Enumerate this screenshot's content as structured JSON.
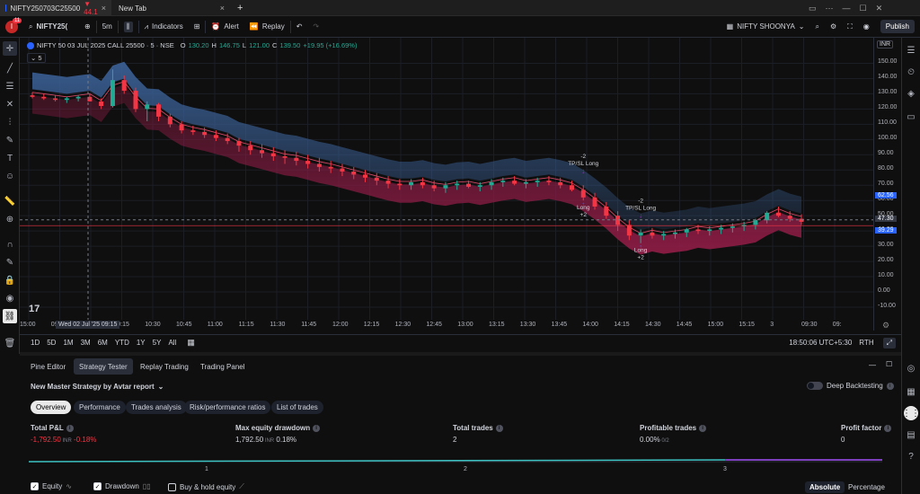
{
  "browser": {
    "tabs": [
      {
        "title": "NIFTY250703C25500",
        "price": "▼ 44.1",
        "close": "×"
      },
      {
        "title": "New Tab",
        "close": "×"
      }
    ],
    "new_tab": "+"
  },
  "toolbar": {
    "avatar_badge": "11",
    "symbol": "NIFTY25(",
    "interval": "5m",
    "indicators": "Indicators",
    "alert": "Alert",
    "replay": "Replay",
    "layout_name": "NIFTY SHOONYA",
    "publish": "Publish"
  },
  "legend": {
    "title": "NIFTY 50 03 JUL 2025 CALL 25500 · 5 · NSE",
    "o_label": "O",
    "o": "130.20",
    "h_label": "H",
    "h": "146.75",
    "l_label": "L",
    "l": "121.00",
    "c_label": "C",
    "c": "139.50",
    "change": "+19.95 (+16.69%)",
    "indicator_count": "5"
  },
  "y_axis": {
    "currency": "INR",
    "ticks": [
      "150.00",
      "140.00",
      "130.00",
      "120.00",
      "110.00",
      "100.00",
      "90.00",
      "80.00",
      "70.00",
      "60.00",
      "50.00",
      "40.00",
      "30.00",
      "20.00",
      "10.00",
      "0.00",
      "-10.00"
    ],
    "price_tags": [
      {
        "value": "62.56",
        "color": "#2962ff"
      },
      {
        "value": "47.30",
        "color": "#363a45"
      },
      {
        "value": "39.29",
        "color": "#2962ff"
      }
    ]
  },
  "x_axis": {
    "ticks": [
      "15:00",
      "09:45",
      "10:00",
      "10:15",
      "10:30",
      "10:45",
      "11:00",
      "11:15",
      "11:30",
      "11:45",
      "12:00",
      "12:15",
      "12:30",
      "12:45",
      "13:00",
      "13:15",
      "13:30",
      "13:45",
      "14:00",
      "14:15",
      "14:30",
      "14:45",
      "15:00",
      "15:15",
      "3",
      "09:30",
      "09:"
    ],
    "crosshair_label": "Wed 02 Jul '25   09:15"
  },
  "annotations": [
    {
      "text": "-2",
      "sub": "TP/SL Long"
    },
    {
      "text": "Long",
      "sub": "+2"
    },
    {
      "text": "-2",
      "sub": "TP/SL Long"
    },
    {
      "text": "Long",
      "sub": "+2"
    }
  ],
  "range_bar": {
    "ranges": [
      "1D",
      "5D",
      "1M",
      "3M",
      "6M",
      "YTD",
      "1Y",
      "5Y",
      "All"
    ],
    "clock": "18:50:06 UTC+5:30",
    "session": "RTH"
  },
  "panel": {
    "tabs": [
      "Pine Editor",
      "Strategy Tester",
      "Replay Trading",
      "Trading Panel"
    ],
    "strategy_name": "New Master Strategy by Avtar report",
    "deep_backtesting": "Deep Backtesting",
    "subtabs": [
      "Overview",
      "Performance",
      "Trades analysis",
      "Risk/performance ratios",
      "List of trades"
    ],
    "metrics": [
      {
        "label": "Total P&L",
        "value": "-1,792.50",
        "unit": "INR",
        "extra": "-0.18%",
        "color": "#f23645"
      },
      {
        "label": "Max equity drawdown",
        "value": "1,792.50",
        "unit": "INR",
        "extra": "0.18%",
        "color": "#d1d4dc"
      },
      {
        "label": "Total trades",
        "value": "2",
        "unit": "",
        "extra": "",
        "color": "#d1d4dc"
      },
      {
        "label": "Profitable trades",
        "value": "0.00%",
        "unit": "0/2",
        "extra": "",
        "color": "#d1d4dc"
      },
      {
        "label": "Profit factor",
        "value": "0",
        "unit": "",
        "extra": "",
        "color": "#d1d4dc"
      }
    ],
    "equity_axis": [
      "1",
      "2",
      "3"
    ],
    "checkboxes": [
      {
        "label": "Equity",
        "checked": true
      },
      {
        "label": "Drawdown",
        "checked": true
      },
      {
        "label": "Buy & hold equity",
        "checked": false
      }
    ],
    "absolute": "Absolute",
    "percentage": "Percentage"
  },
  "colors": {
    "up": "#22ab94",
    "down": "#f23645",
    "band_top": "#3a5f94",
    "band_bottom": "#8c1c44"
  },
  "chart_data": {
    "type": "candlestick",
    "symbol": "NIFTY 50 03 JUL 2025 CALL 25500",
    "ylim": [
      -10,
      155
    ],
    "candles": [
      [
        129,
        131,
        127,
        128
      ],
      [
        128,
        130,
        126,
        127
      ],
      [
        127,
        129,
        125,
        126
      ],
      [
        126,
        128,
        124,
        127
      ],
      [
        127,
        129,
        125,
        128
      ],
      [
        128,
        130,
        126,
        125
      ],
      [
        125,
        127,
        120,
        122
      ],
      [
        122,
        146,
        121,
        139
      ],
      [
        139,
        142,
        130,
        132
      ],
      [
        132,
        134,
        118,
        120
      ],
      [
        120,
        125,
        112,
        123
      ],
      [
        123,
        124,
        112,
        115
      ],
      [
        115,
        117,
        108,
        110
      ],
      [
        110,
        112,
        104,
        106
      ],
      [
        106,
        109,
        103,
        105
      ],
      [
        105,
        108,
        101,
        103
      ],
      [
        103,
        106,
        99,
        101
      ],
      [
        101,
        104,
        97,
        99
      ],
      [
        99,
        101,
        92,
        96
      ],
      [
        96,
        99,
        90,
        93
      ],
      [
        93,
        97,
        88,
        91
      ],
      [
        91,
        95,
        86,
        89
      ],
      [
        89,
        93,
        84,
        88
      ],
      [
        88,
        92,
        83,
        86
      ],
      [
        86,
        90,
        81,
        84
      ],
      [
        84,
        88,
        79,
        82
      ],
      [
        82,
        86,
        78,
        81
      ],
      [
        81,
        84,
        76,
        79
      ],
      [
        79,
        82,
        74,
        77
      ],
      [
        77,
        80,
        72,
        75
      ],
      [
        75,
        78,
        70,
        73
      ],
      [
        73,
        76,
        68,
        71
      ],
      [
        71,
        74,
        67,
        70
      ],
      [
        70,
        74,
        67,
        72
      ],
      [
        72,
        75,
        68,
        70
      ],
      [
        70,
        73,
        66,
        68
      ],
      [
        68,
        72,
        65,
        70
      ],
      [
        70,
        73,
        67,
        71
      ],
      [
        71,
        73,
        68,
        69
      ],
      [
        69,
        72,
        66,
        70
      ],
      [
        70,
        74,
        67,
        72
      ],
      [
        72,
        75,
        69,
        73
      ],
      [
        73,
        76,
        70,
        71
      ],
      [
        71,
        74,
        68,
        72
      ],
      [
        72,
        75,
        69,
        73
      ],
      [
        73,
        76,
        70,
        72
      ],
      [
        72,
        75,
        68,
        70
      ],
      [
        70,
        73,
        66,
        67
      ],
      [
        67,
        70,
        60,
        62
      ],
      [
        62,
        65,
        54,
        56
      ],
      [
        56,
        59,
        48,
        50
      ],
      [
        50,
        53,
        40,
        44
      ],
      [
        44,
        47,
        34,
        37
      ],
      [
        37,
        41,
        32,
        39
      ],
      [
        39,
        42,
        35,
        37
      ],
      [
        37,
        40,
        34,
        38
      ],
      [
        38,
        41,
        35,
        39
      ],
      [
        39,
        42,
        36,
        41
      ],
      [
        41,
        44,
        38,
        40
      ],
      [
        40,
        43,
        37,
        41
      ],
      [
        41,
        44,
        38,
        42
      ],
      [
        42,
        45,
        39,
        43
      ],
      [
        43,
        46,
        40,
        44
      ],
      [
        44,
        48,
        41,
        47
      ],
      [
        47,
        53,
        45,
        52
      ],
      [
        52,
        56,
        49,
        50
      ],
      [
        50,
        53,
        46,
        48
      ],
      [
        48,
        51,
        44,
        46
      ]
    ]
  }
}
